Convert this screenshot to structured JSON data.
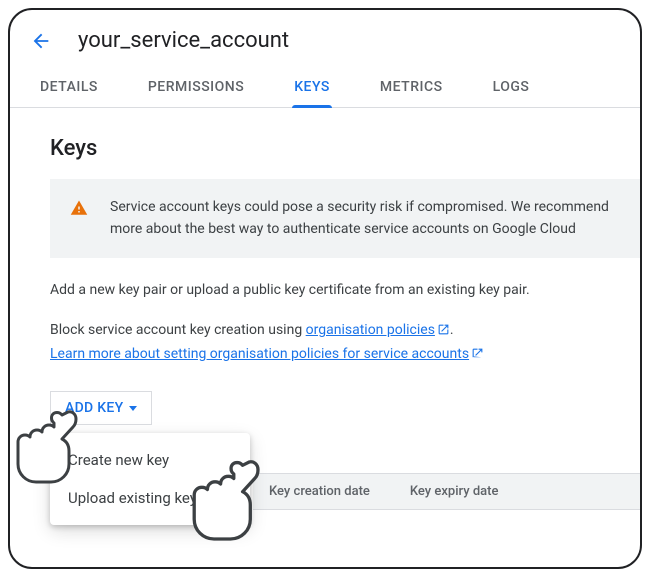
{
  "header": {
    "title": "your_service_account"
  },
  "tabs": {
    "details": "DETAILS",
    "permissions": "PERMISSIONS",
    "keys": "KEYS",
    "metrics": "METRICS",
    "logs": "LOGS"
  },
  "section_title": "Keys",
  "warning": {
    "line1": "Service account keys could pose a security risk if compromised. We recommend",
    "line2": "more about the best way to authenticate service accounts on Google Cloud"
  },
  "para_add": "Add a new key pair or upload a public key certificate from an existing key pair.",
  "block_prefix": "Block service account key creation using ",
  "block_link": "organisation policies",
  "learn_link": "Learn more about setting organisation policies for service accounts",
  "add_key": {
    "button": "ADD KEY",
    "create": "Create new key",
    "upload": "Upload existing key"
  },
  "table": {
    "col_creation": "Key creation date",
    "col_expiry": "Key expiry date"
  }
}
